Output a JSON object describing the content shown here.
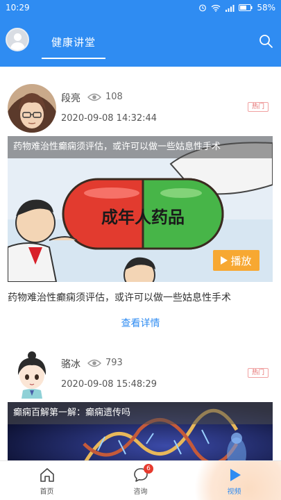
{
  "status_bar": {
    "time": "10:29",
    "battery": "58%"
  },
  "header": {
    "active_tab": "健康讲堂"
  },
  "posts": [
    {
      "author": "段亮",
      "views": "108",
      "date": "2020-09-08 14:32:44",
      "badge": "热门",
      "media_title": "药物难治性癫痫须评估，或许可以做一些姑息性手术",
      "media_caption": "成年人药品",
      "play_label": "播放",
      "description": "药物难治性癫痫须评估，或许可以做一些姑息性手术",
      "detail_link": "查看详情"
    },
    {
      "author": "骆冰",
      "views": "793",
      "date": "2020-09-08 15:48:29",
      "badge": "热门",
      "media_title": "癫痫百解第一解：癫痫遗传吗"
    }
  ],
  "bottom_nav": [
    {
      "label": "首页",
      "icon": "home-icon"
    },
    {
      "label": "咨询",
      "icon": "chat-icon",
      "badge": "6"
    },
    {
      "label": "视频",
      "icon": "play-icon",
      "active": true
    }
  ],
  "colors": {
    "primary": "#2f8cf2",
    "hot_badge": "#e36a6a",
    "play_button": "#f7a832",
    "nav_badge": "#e63a2e"
  }
}
